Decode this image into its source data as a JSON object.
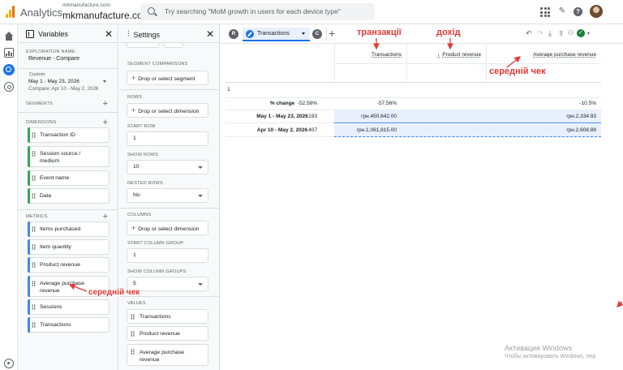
{
  "header": {
    "app_name": "Analytics",
    "account_small": "mkmanufacture.com",
    "account_name": "mkmanufacture.com",
    "search_placeholder": "Try searching \"MoM growth in users for each device type\""
  },
  "variables": {
    "title": "Variables",
    "exploration_name_label": "EXPLORATION NAME:",
    "exploration_name": "Revenue - Compare",
    "date_chip": "Custom",
    "date_range": "May 1 - May 23, 2026",
    "compare": "Compare: Apr 10 - May 2, 2026",
    "segments_label": "SEGMENTS",
    "dimensions_label": "DIMENSIONS",
    "dimensions": [
      "Transaction ID",
      "Session source / medium",
      "Event name",
      "Date"
    ],
    "metrics_label": "METRICS",
    "metrics": [
      "Items purchased",
      "Item quantity",
      "Product revenue",
      "Average purchase revenue",
      "Sessions",
      "Transactions"
    ]
  },
  "settings": {
    "title": "Settings",
    "segment_comparisons_label": "SEGMENT COMPARISONS",
    "drop_segment": "Drop or select segment",
    "rows_label": "ROWS",
    "drop_dimension": "Drop or select dimension",
    "start_row_label": "START ROW",
    "start_row": "1",
    "show_rows_label": "SHOW ROWS",
    "show_rows": "10",
    "nested_rows_label": "NESTED ROWS",
    "nested_rows": "No",
    "columns_label": "COLUMNS",
    "drop_dimension_cols": "Drop or select dimension",
    "start_column_group_label": "START COLUMN GROUP",
    "start_column_group": "1",
    "show_column_groups_label": "SHOW COLUMN GROUPS",
    "show_column_groups": "5",
    "values_label": "VALUES",
    "values": [
      "Transactions",
      "Product revenue",
      "Average purchase revenue"
    ]
  },
  "canvas": {
    "tab_badge_left": "R",
    "tab_name": "Transactions",
    "tab_badge_right": "C",
    "add_tab": "+"
  },
  "table": {
    "headers": [
      "Transactions",
      "Product revenue",
      "Average purchase revenue"
    ],
    "sort_arrow": "↓",
    "first_row_label": "1",
    "rows": [
      {
        "label": "% change",
        "values": [
          "-52.58%",
          "-57.56%",
          "-10.5%"
        ]
      },
      {
        "label": "May 1 - May 23, 2026",
        "values": [
          "193",
          "грн.450,642.00",
          "грн.2,334.93"
        ]
      },
      {
        "label": "Apr 10 - May 2, 2026",
        "values": [
          "407",
          "грн.1,061,815.00",
          "грн.2,608.88"
        ]
      }
    ]
  },
  "annotations": {
    "transactions": "транзакції",
    "revenue": "дохід",
    "avg_check_table": "середній чек",
    "avg_check_sidebar": "середній чек"
  },
  "watermark": {
    "line1": "Активация Windows",
    "line2": "Чтобы активировать Windows, пер"
  },
  "colors": {
    "accent": "#1a73e8",
    "dimension_bar": "#34a853",
    "metric_bar": "#4285f4",
    "annotation": "#e53935",
    "selected_row": "#e8f0fe"
  }
}
